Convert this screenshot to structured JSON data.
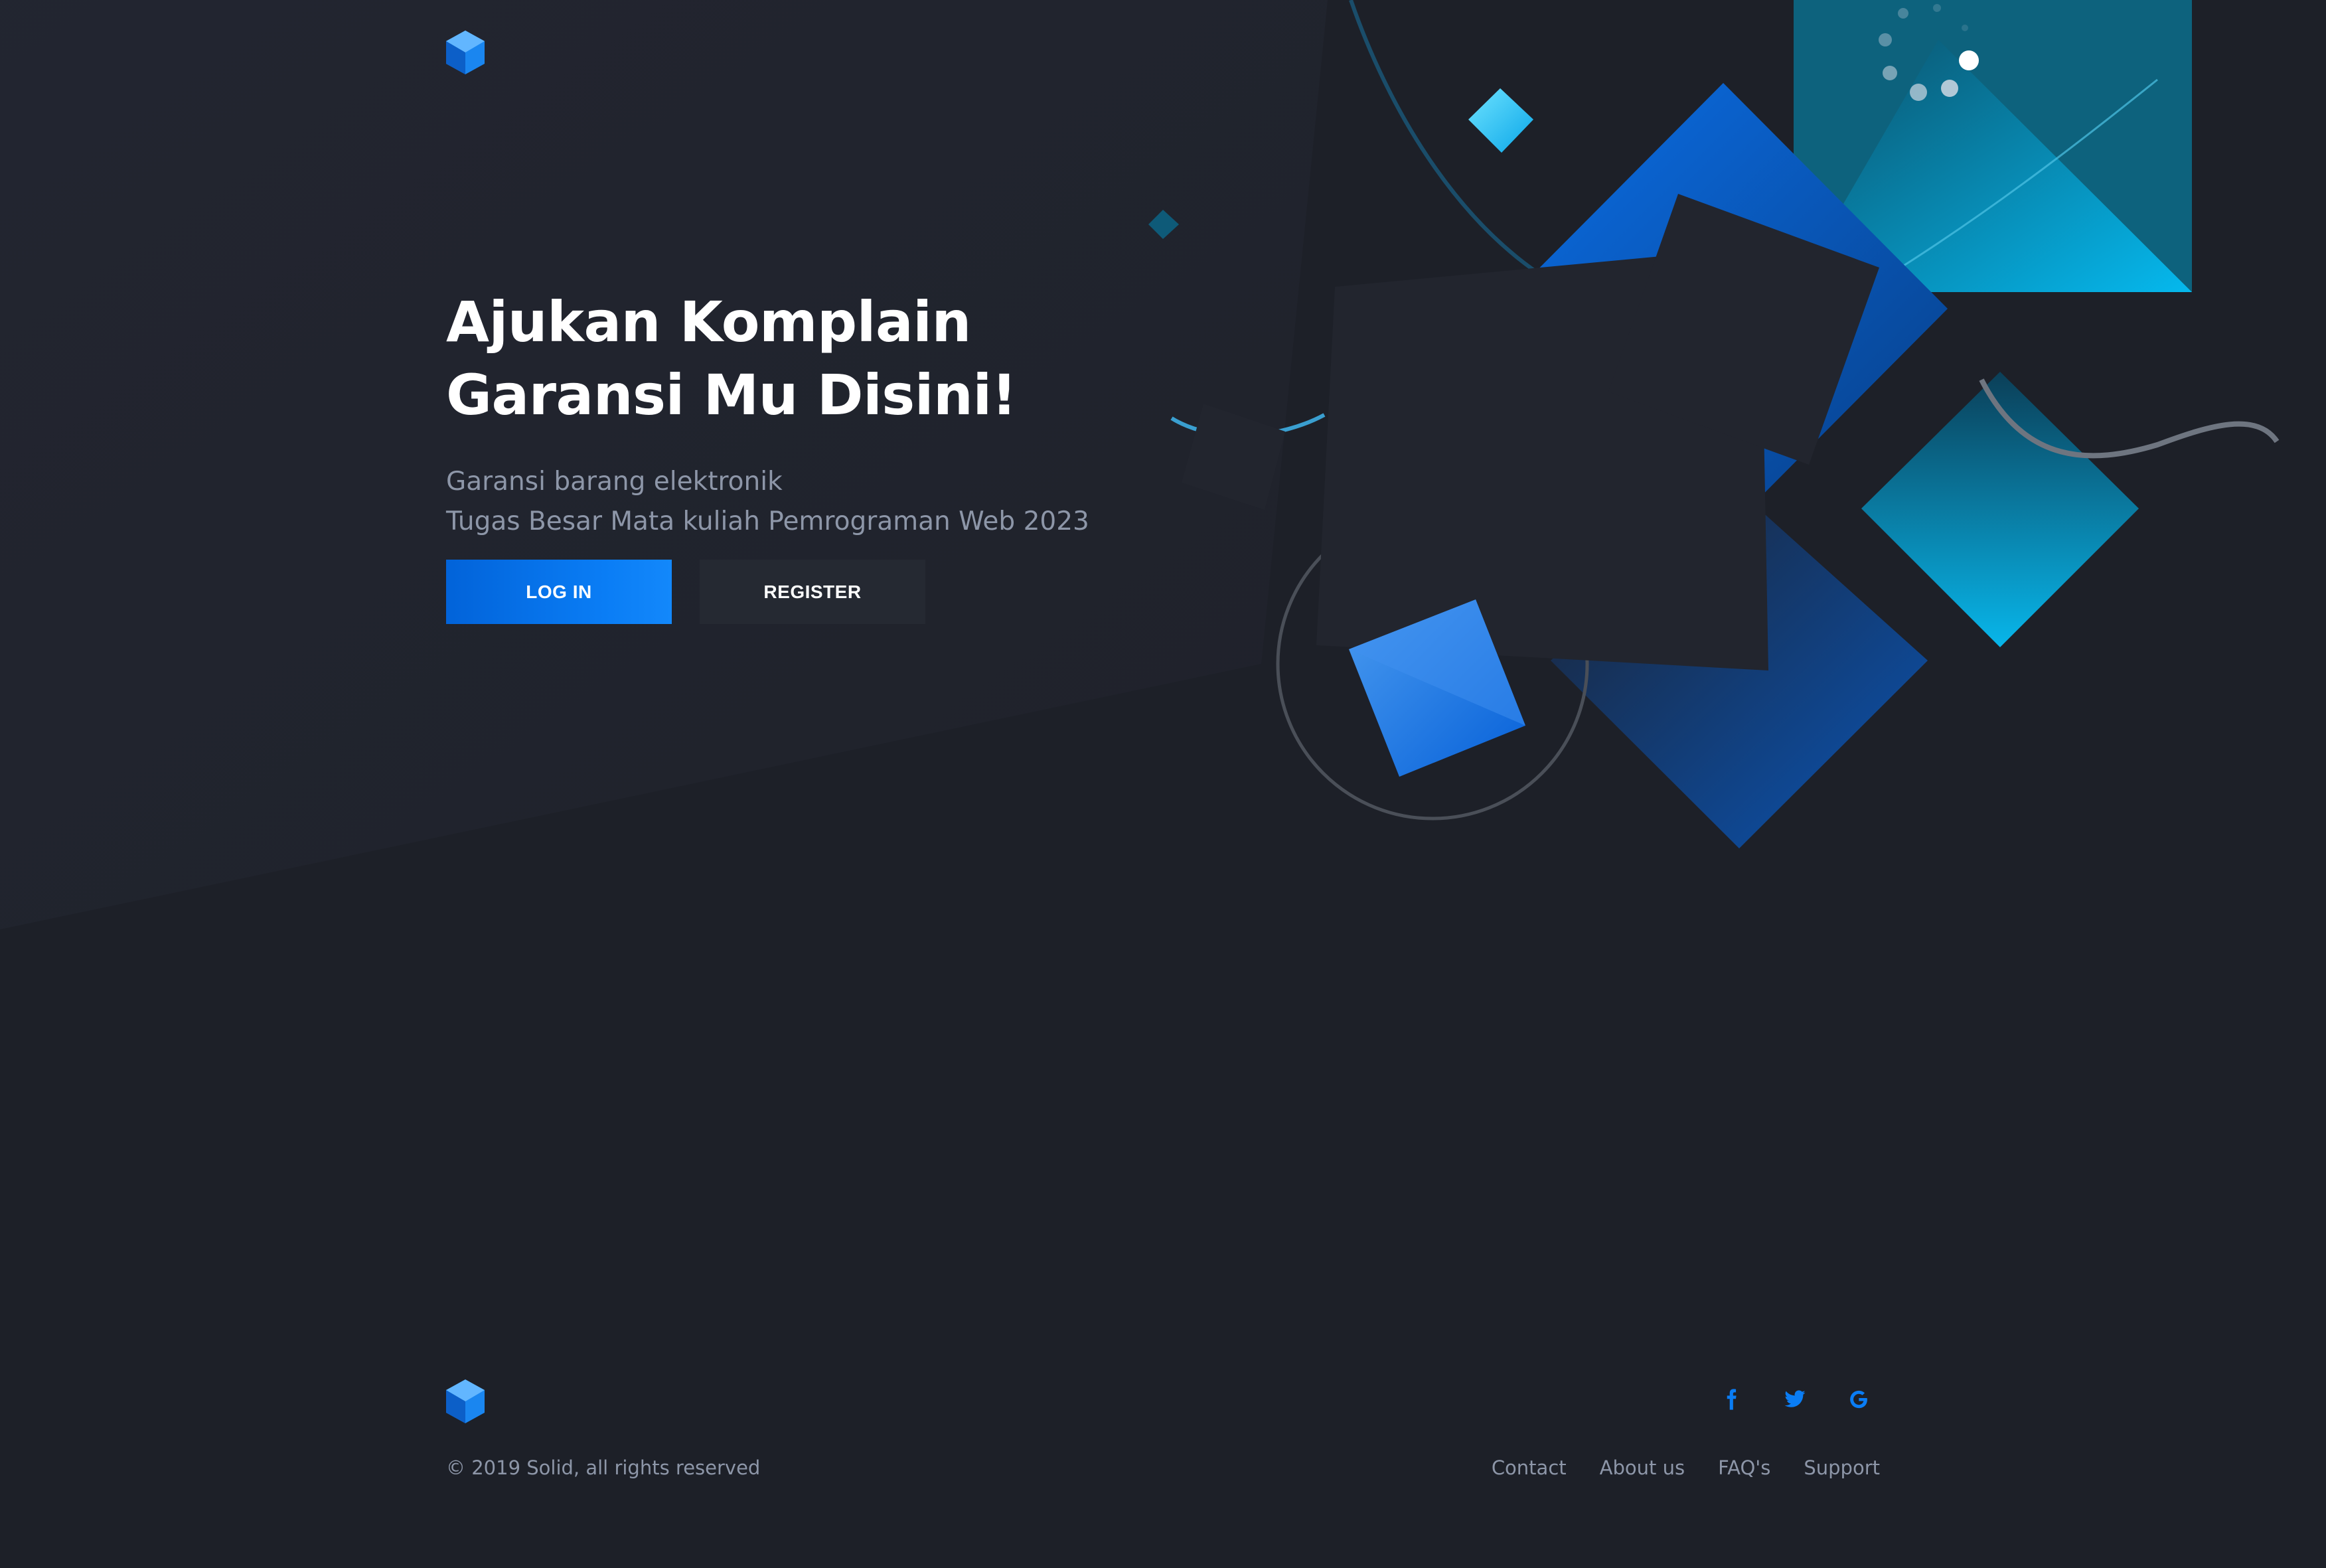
{
  "hero": {
    "title_line1": "Ajukan Komplain",
    "title_line2": "Garansi Mu Disini!",
    "subtitle_line1": "Garansi barang elektronik",
    "subtitle_line2": "Tugas Besar Mata kuliah Pemrograman Web 2023"
  },
  "actions": {
    "login_label": "LOG IN",
    "register_label": "REGISTER"
  },
  "footer": {
    "copyright": "© 2019 Solid, all rights reserved",
    "links": [
      "Contact",
      "About us",
      "FAQ's",
      "Support"
    ],
    "social": [
      {
        "icon": "facebook-icon"
      },
      {
        "icon": "twitter-icon"
      },
      {
        "icon": "google-icon"
      }
    ]
  },
  "colors": {
    "background": "#1d2028",
    "accent": "#0a7df5",
    "text_muted": "#8d96a8",
    "card": "#252932"
  }
}
